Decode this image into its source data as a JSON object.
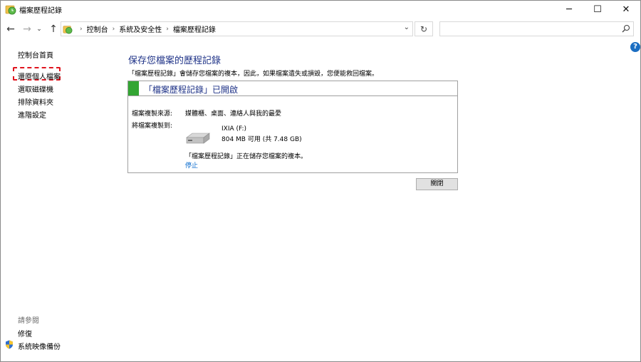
{
  "window": {
    "title": "檔案歷程記錄",
    "minimize_glyph": "─",
    "maximize_glyph": "☐",
    "close_glyph": "✕"
  },
  "nav": {
    "back_glyph": "←",
    "forward_glyph": "→",
    "recent_glyph": "⌄",
    "up_glyph": "↑",
    "breadcrumbs": [
      "控制台",
      "系統及安全性",
      "檔案歷程記錄"
    ],
    "dropdown_glyph": "⌄",
    "refresh_glyph": "↻",
    "search_placeholder": ""
  },
  "sidebar": {
    "home": "控制台首頁",
    "restore": "還原個人檔案",
    "select_drive": "選取磁碟機",
    "exclude": "排除資料夾",
    "advanced": "進階設定",
    "see_also": "請參閱",
    "recovery": "修復",
    "system_image": "系統映像備份"
  },
  "main": {
    "title": "保存您檔案的歷程記錄",
    "description": "「檔案歷程記錄」會儲存您檔案的複本，因此，如果檔案遺失或損毀，您便能救回檔案。",
    "status": "「檔案歷程記錄」已開啟",
    "source_label": "檔案複製來源:",
    "source_value": "媒體櫃、桌面、連絡人與我的最愛",
    "dest_label": "將檔案複製到:",
    "drive_name": "IXIA (F:)",
    "drive_space": "804 MB 可用 (共 7.48 GB)",
    "progress_text": "「檔案歷程記錄」正在儲存您檔案的複本。",
    "stop_link": "停止",
    "close_button": "關閉"
  },
  "colors": {
    "accent_title": "#1e3287",
    "status_on": "#33a533",
    "link": "#0066cc",
    "highlight": "#e0141e"
  },
  "icons": {
    "help": "?"
  }
}
